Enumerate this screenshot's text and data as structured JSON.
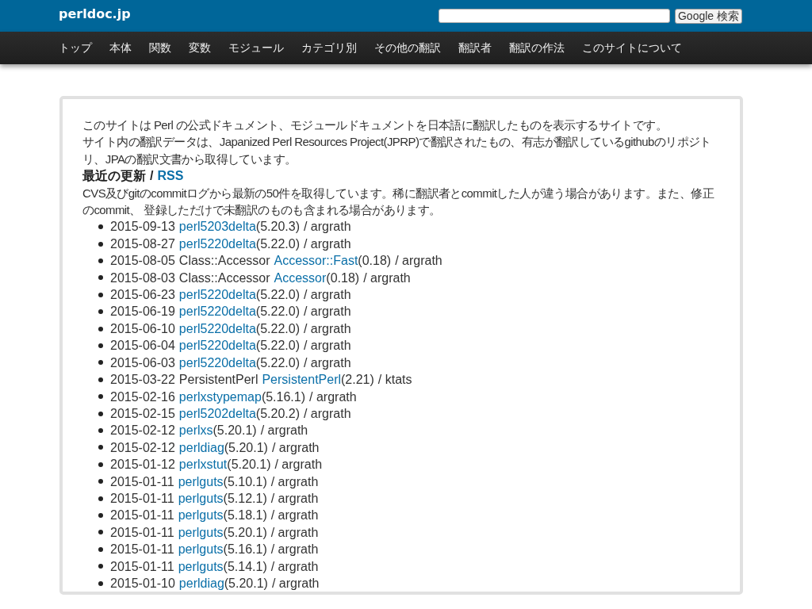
{
  "header": {
    "logo": "perldoc.jp",
    "search": {
      "button": "Google 検索"
    }
  },
  "nav": [
    {
      "label": "トップ"
    },
    {
      "label": "本体"
    },
    {
      "label": "関数"
    },
    {
      "label": "変数"
    },
    {
      "label": "モジュール"
    },
    {
      "label": "カテゴリ別"
    },
    {
      "label": "その他の翻訳"
    },
    {
      "label": "翻訳者"
    },
    {
      "label": "翻訳の作法"
    },
    {
      "label": "このサイトについて"
    }
  ],
  "intro": [
    "このサイトは Perl の公式ドキュメント、モジュールドキュメントを日本語に翻訳したものを表示するサイトです。",
    "サイト内の翻訳データは、Japanized Perl Resources Project(JPRP)で翻訳されたもの、有志が翻訳しているgithubのリポジトリ、JPAの翻訳文書から取得しています。"
  ],
  "updates": {
    "heading": "最近の更新",
    "separator": "/",
    "rss": "RSS",
    "description": "CVS及びgitのcommitログから最新の50件を取得しています。稀に翻訳者とcommitした人が違う場合があります。また、修正のcommit、 登録しただけで未翻訳のものも含まれる場合があります。",
    "items": [
      {
        "date": "2015-09-13",
        "link": "perl5203delta",
        "version": "(5.20.3)",
        "author": "/ argrath"
      },
      {
        "date": "2015-08-27",
        "link": "perl5220delta",
        "version": "(5.22.0)",
        "author": "/ argrath"
      },
      {
        "date": "2015-08-05",
        "prefix": "Class::Accessor",
        "link": "Accessor::Fast",
        "version": "(0.18)",
        "author": "/ argrath"
      },
      {
        "date": "2015-08-03",
        "prefix": "Class::Accessor",
        "link": "Accessor",
        "version": "(0.18)",
        "author": "/ argrath"
      },
      {
        "date": "2015-06-23",
        "link": "perl5220delta",
        "version": "(5.22.0)",
        "author": "/ argrath"
      },
      {
        "date": "2015-06-19",
        "link": "perl5220delta",
        "version": "(5.22.0)",
        "author": "/ argrath"
      },
      {
        "date": "2015-06-10",
        "link": "perl5220delta",
        "version": "(5.22.0)",
        "author": "/ argrath"
      },
      {
        "date": "2015-06-04",
        "link": "perl5220delta",
        "version": "(5.22.0)",
        "author": "/ argrath"
      },
      {
        "date": "2015-06-03",
        "link": "perl5220delta",
        "version": "(5.22.0)",
        "author": "/ argrath"
      },
      {
        "date": "2015-03-22",
        "prefix": "PersistentPerl",
        "link": "PersistentPerl",
        "version": "(2.21)",
        "author": "/ ktats"
      },
      {
        "date": "2015-02-16",
        "link": "perlxstypemap",
        "version": "(5.16.1)",
        "author": "/ argrath"
      },
      {
        "date": "2015-02-15",
        "link": "perl5202delta",
        "version": "(5.20.2)",
        "author": "/ argrath"
      },
      {
        "date": "2015-02-12",
        "link": "perlxs",
        "version": "(5.20.1)",
        "author": "/ argrath"
      },
      {
        "date": "2015-02-12",
        "link": "perldiag",
        "version": "(5.20.1)",
        "author": "/ argrath"
      },
      {
        "date": "2015-01-12",
        "link": "perlxstut",
        "version": "(5.20.1)",
        "author": "/ argrath"
      },
      {
        "date": "2015-01-11",
        "link": "perlguts",
        "version": "(5.10.1)",
        "author": "/ argrath"
      },
      {
        "date": "2015-01-11",
        "link": "perlguts",
        "version": "(5.12.1)",
        "author": "/ argrath"
      },
      {
        "date": "2015-01-11",
        "link": "perlguts",
        "version": "(5.18.1)",
        "author": "/ argrath"
      },
      {
        "date": "2015-01-11",
        "link": "perlguts",
        "version": "(5.20.1)",
        "author": "/ argrath"
      },
      {
        "date": "2015-01-11",
        "link": "perlguts",
        "version": "(5.16.1)",
        "author": "/ argrath"
      },
      {
        "date": "2015-01-11",
        "link": "perlguts",
        "version": "(5.14.1)",
        "author": "/ argrath"
      },
      {
        "date": "2015-01-10",
        "link": "perldiag",
        "version": "(5.20.1)",
        "author": "/ argrath"
      }
    ]
  }
}
